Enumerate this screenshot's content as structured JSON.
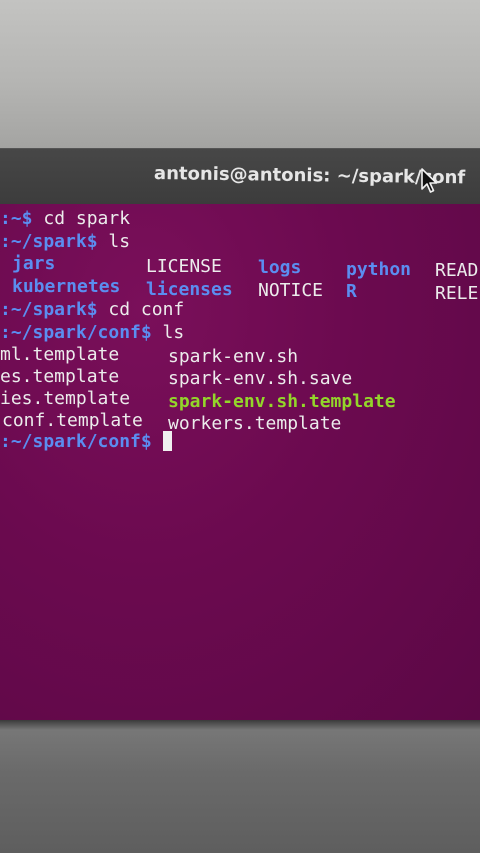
{
  "window": {
    "title": "antonis@antonis: ~/spark/conf"
  },
  "terminal": {
    "lines": [
      {
        "prompt": ":~$",
        "cmd": " cd spark"
      },
      {
        "prompt": ":~/spark$",
        "cmd": " ls"
      }
    ],
    "ls_spark": {
      "row1": {
        "c1": "jars",
        "c2": "LICENSE",
        "c3": "logs",
        "c4": "python",
        "c5": "READ"
      },
      "row2": {
        "c1": "kubernetes",
        "c2": "licenses",
        "c3": "NOTICE",
        "c4": "R",
        "c5": "RELE"
      }
    },
    "line_cd_conf": {
      "prompt": ":~/spark$",
      "cmd": " cd conf"
    },
    "line_ls_conf": {
      "prompt": ":~/spark/conf$",
      "cmd": " ls"
    },
    "ls_conf": {
      "row1": {
        "left": "ml.template",
        "right": "spark-env.sh"
      },
      "row2": {
        "left": "es.template",
        "right": "spark-env.sh.save"
      },
      "row3": {
        "left": "ies.template",
        "right": "spark-env.sh.template"
      },
      "row4": {
        "left": "conf.template",
        "right": "workers.template"
      }
    },
    "final_prompt": ":~/spark/conf$"
  },
  "colors": {
    "terminal_bg": "#6b0a4f",
    "dir_blue": "#5b8df0",
    "exec_green": "#93d62a",
    "text": "#ececec",
    "titlebar": "#3c3c3c"
  },
  "icons": {
    "pointer": "mouse-pointer-icon"
  }
}
